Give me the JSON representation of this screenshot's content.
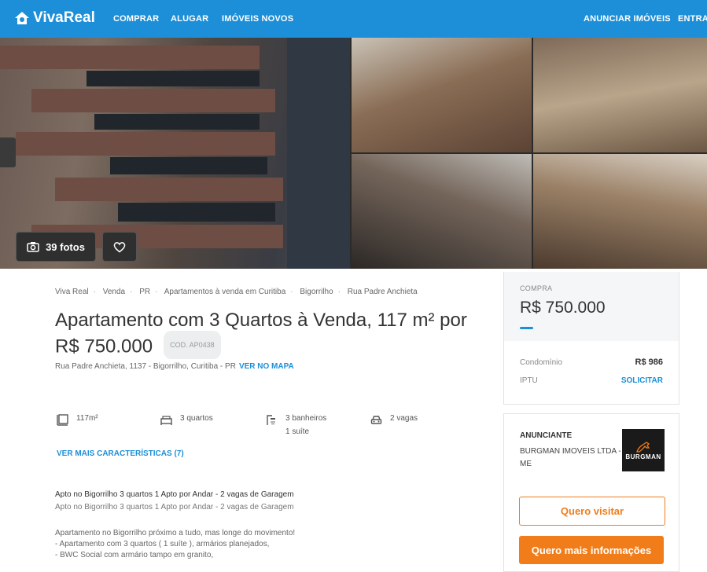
{
  "header": {
    "logo": "VivaReal",
    "nav": [
      "COMPRAR",
      "ALUGAR",
      "IMÓVEIS NOVOS"
    ],
    "right_nav": [
      "ANUNCIAR IMÓVEIS",
      "ENTRAR"
    ],
    "color": "#1c8fd8"
  },
  "gallery": {
    "photos_label": "39 fotos",
    "camera_icon": "camera-icon",
    "favorite_icon": "heart-icon"
  },
  "breadcrumb": [
    "Viva Real",
    "Venda",
    "PR",
    "Apartamentos à venda em Curitiba",
    "Bigorrilho",
    "Rua Padre Anchieta"
  ],
  "listing": {
    "title": "Apartamento com 3 Quartos à Venda, 117 m² por R$ 750.000",
    "code": "COD. AP0438",
    "address": "Rua Padre Anchieta, 1137 - Bigorrilho, Curitiba - PR",
    "map_link": "VER NO MAPA"
  },
  "features": {
    "area": "117m²",
    "bedrooms": "3 quartos",
    "bathrooms": "3 banheiros",
    "suites": "1 suíte",
    "parking": "2 vagas",
    "more_link": "VER MAIS CARACTERÍSTICAS (7)"
  },
  "description": {
    "heading": "Apto no Bigorrilho 3 quartos 1 Apto por Andar - 2 vagas de Garagem",
    "subheading": "Apto no Bigorrilho 3 quartos 1 Apto por Andar - 2 vagas de Garagem",
    "lines": [
      "Apartamento no Bigorrilho próximo a tudo, mas longe do movimento!",
      "- Apartamento com 3 quartos ( 1 suíte ), armários planejados,",
      "- BWC Social com armário tampo em granito,"
    ]
  },
  "price_card": {
    "label": "COMPRA",
    "price": "R$ 750.000",
    "condo_label": "Condomínio",
    "condo_value": "R$ 986",
    "iptu_label": "IPTU",
    "iptu_action": "SOLICITAR"
  },
  "advertiser": {
    "label": "ANUNCIANTE",
    "name": "BURGMAN IMOVEIS LTDA - ME",
    "logo_text": "BURGMAN",
    "visit_button": "Quero visitar",
    "info_button": "Quero mais informações",
    "accent": "#f07d1a"
  }
}
